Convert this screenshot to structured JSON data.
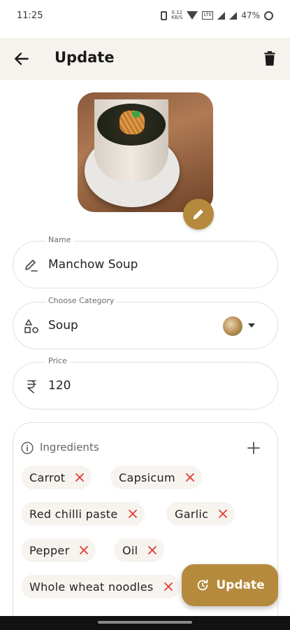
{
  "status_bar": {
    "time": "11:25",
    "net_speed": "0.12\nKB/S",
    "volte": "VoLTE",
    "battery": "47%"
  },
  "header": {
    "title": "Update",
    "back_icon": "arrow-left-icon",
    "delete_icon": "trash-icon"
  },
  "photo": {
    "alt": "Manchow Soup",
    "edit_icon": "pencil-icon"
  },
  "form": {
    "name": {
      "label": "Name",
      "value": "Manchow Soup",
      "icon": "edit-field-icon"
    },
    "category": {
      "label": "Choose Category",
      "value": "Soup",
      "icon": "shapes-icon"
    },
    "price": {
      "label": "Price",
      "value": "120",
      "icon": "rupee-icon"
    }
  },
  "ingredients": {
    "title": "Ingredients",
    "items": [
      "Carrot",
      "Capsicum",
      "Red chilli paste",
      "Garlic",
      "Pepper",
      "Oil",
      "Whole wheat noodles"
    ]
  },
  "fab": {
    "label": "Update",
    "icon": "refresh-icon"
  },
  "colors": {
    "accent": "#b58a3c",
    "app_bar": "#f6f3ee",
    "chip_bg": "#f7f4ef",
    "remove": "#e53935"
  }
}
